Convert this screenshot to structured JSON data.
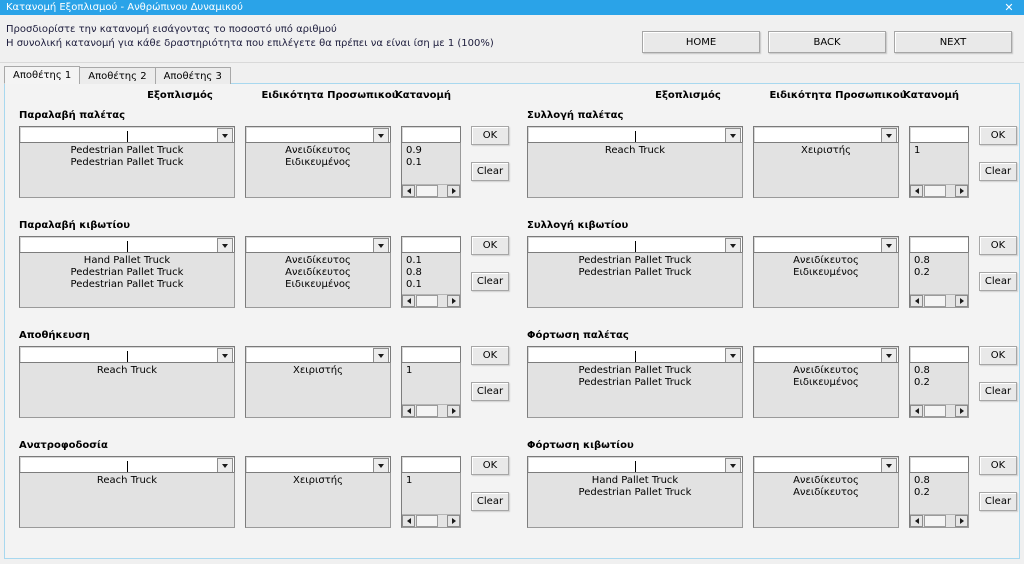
{
  "window": {
    "title": "Κατανομή Εξοπλισμού - Ανθρώπινου Δυναμικού",
    "close_glyph": "✕",
    "accent_color": "#2aa3e8"
  },
  "header": {
    "instruction_line1": "Προσδιορίστε την κατανομή εισάγοντας το ποσοστό υπό αριθμού",
    "instruction_line2": "Η συνολική κατανομή για κάθε δραστηριότητα που επιλέγετε θα πρέπει να είναι ίση με 1 (100%)",
    "buttons": [
      {
        "label": "HOME",
        "name": "home-button"
      },
      {
        "label": "BACK",
        "name": "back-button"
      },
      {
        "label": "NEXT",
        "name": "next-button"
      }
    ]
  },
  "tabs": [
    {
      "label": "Αποθέτης 1",
      "active": true
    },
    {
      "label": "Αποθέτης 2",
      "active": false
    },
    {
      "label": "Αποθέτης 3",
      "active": false
    }
  ],
  "column_headers": {
    "equipment": "Εξοπλισμός",
    "skill": "Ειδικότητα Προσωπικού",
    "allocation": "Κατανομή"
  },
  "row_buttons": {
    "ok": "OK",
    "clear": "Clear"
  },
  "combo_placeholder": "",
  "allocation_input_value": "",
  "groups_left": [
    {
      "title": "Παραλαβή παλέτας",
      "equipment": [
        "Pedestrian Pallet Truck",
        "Pedestrian Pallet Truck"
      ],
      "skill": [
        "Ανειδίκευτος",
        "Ειδικευμένος"
      ],
      "allocation": [
        "0.9",
        "0.1"
      ]
    },
    {
      "title": "Παραλαβή κιβωτίου",
      "equipment": [
        "Hand Pallet Truck",
        "Pedestrian Pallet Truck",
        "Pedestrian Pallet Truck"
      ],
      "skill": [
        "Ανειδίκευτος",
        "Ανειδίκευτος",
        "Ειδικευμένος"
      ],
      "allocation": [
        "0.1",
        "0.8",
        "0.1"
      ]
    },
    {
      "title": "Αποθήκευση",
      "equipment": [
        "Reach Truck"
      ],
      "skill": [
        "Χειριστής"
      ],
      "allocation": [
        "1"
      ]
    },
    {
      "title": "Ανατροφοδοσία",
      "equipment": [
        "Reach Truck"
      ],
      "skill": [
        "Χειριστής"
      ],
      "allocation": [
        "1"
      ]
    }
  ],
  "groups_right": [
    {
      "title": "Συλλογή παλέτας",
      "equipment": [
        "Reach Truck"
      ],
      "skill": [
        "Χειριστής"
      ],
      "allocation": [
        "1"
      ]
    },
    {
      "title": "Συλλογή κιβωτίου",
      "equipment": [
        "Pedestrian Pallet Truck",
        "Pedestrian Pallet Truck"
      ],
      "skill": [
        "Ανειδίκευτος",
        "Ειδικευμένος"
      ],
      "allocation": [
        "0.8",
        "0.2"
      ]
    },
    {
      "title": "Φόρτωση παλέτας",
      "equipment": [
        "Pedestrian Pallet Truck",
        "Pedestrian Pallet Truck"
      ],
      "skill": [
        "Ανειδίκευτος",
        "Ειδικευμένος"
      ],
      "allocation": [
        "0.8",
        "0.2"
      ]
    },
    {
      "title": "Φόρτωση κιβωτίου",
      "equipment": [
        "Hand Pallet Truck",
        "Pedestrian Pallet Truck"
      ],
      "skill": [
        "Ανειδίκευτος",
        "Ανειδίκευτος"
      ],
      "allocation": [
        "0.8",
        "0.2"
      ]
    }
  ]
}
